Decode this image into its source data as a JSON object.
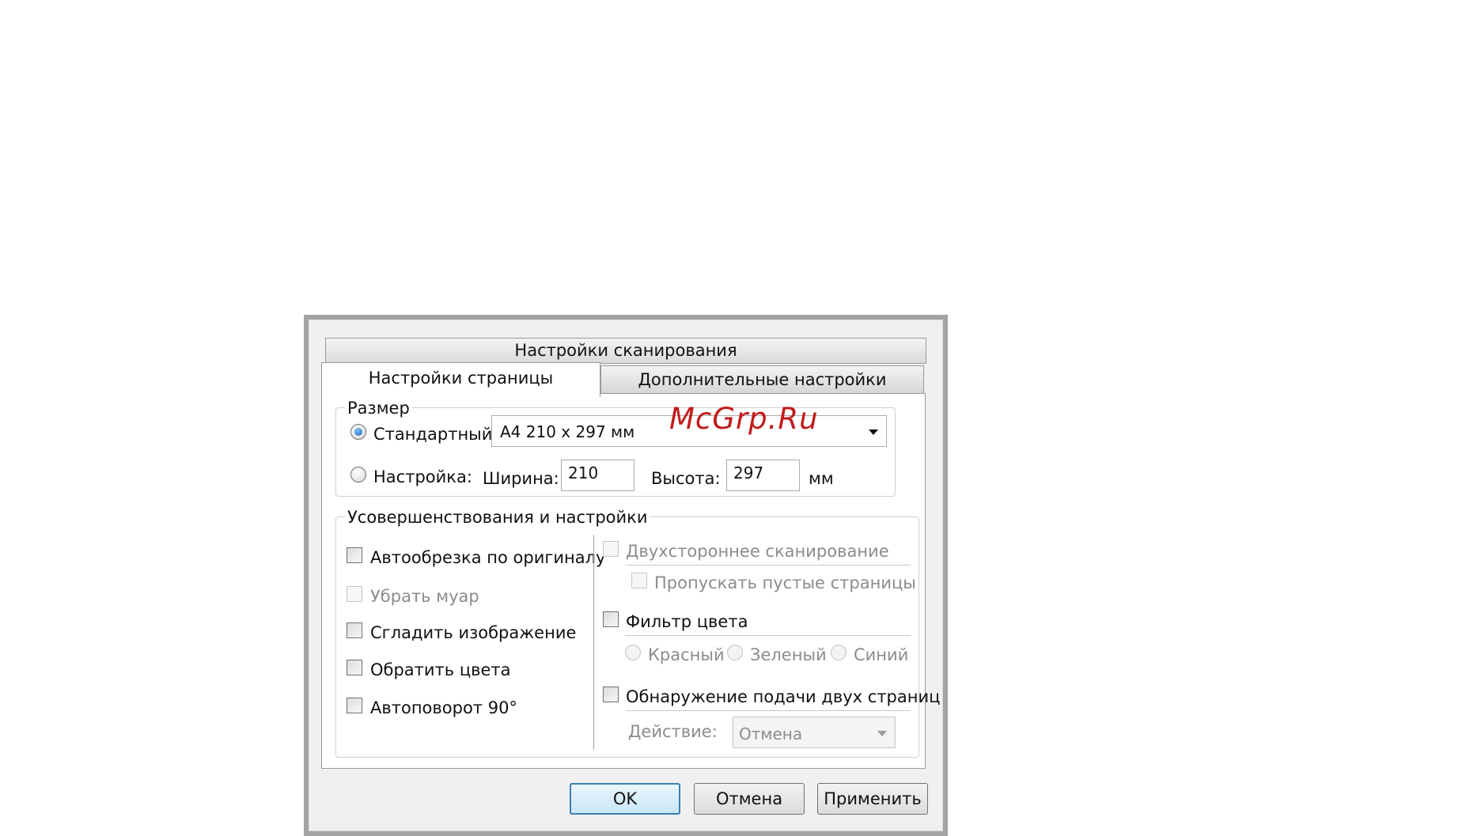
{
  "window": {
    "title": "Настройки сканирования",
    "tabs": [
      {
        "label": "Настройки страницы",
        "active": true
      },
      {
        "label": "Дополнительные настройки",
        "active": false
      }
    ]
  },
  "watermark": "McGrp.Ru",
  "size_group": {
    "legend": "Размер",
    "standard_label": "Стандартный:",
    "standard_selected": true,
    "standard_value": "A4 210 x 297 мм",
    "custom_label": "Настройка:",
    "width_label": "Ширина:",
    "width_value": "210",
    "height_label": "Высота:",
    "height_value": "297",
    "unit": "мм"
  },
  "improvements": {
    "legend": "Усовершенствования и настройки",
    "left": [
      {
        "label": "Автообрезка по оригиналу",
        "enabled": true
      },
      {
        "label": "Убрать муар",
        "enabled": false
      },
      {
        "label": "Сгладить изображение",
        "enabled": true
      },
      {
        "label": "Обратить цвета",
        "enabled": true
      },
      {
        "label": "Автоповорот 90°",
        "enabled": true
      }
    ],
    "duplex_label": "Двухстороннее сканирование",
    "skip_blank_label": "Пропускать пустые страницы",
    "color_filter_label": "Фильтр цвета",
    "colors": [
      "Красный",
      "Зеленый",
      "Синий"
    ],
    "double_feed_label": "Обнаружение подачи двух страниц",
    "action_label": "Действие:",
    "action_value": "Отмена"
  },
  "buttons": {
    "ok": "OK",
    "cancel": "Отмена",
    "apply": "Применить"
  },
  "colors": {
    "accent_blue": "#1d5fb6",
    "default_button_border": "#3c7fb1",
    "watermark_red": "#c21b1b"
  }
}
